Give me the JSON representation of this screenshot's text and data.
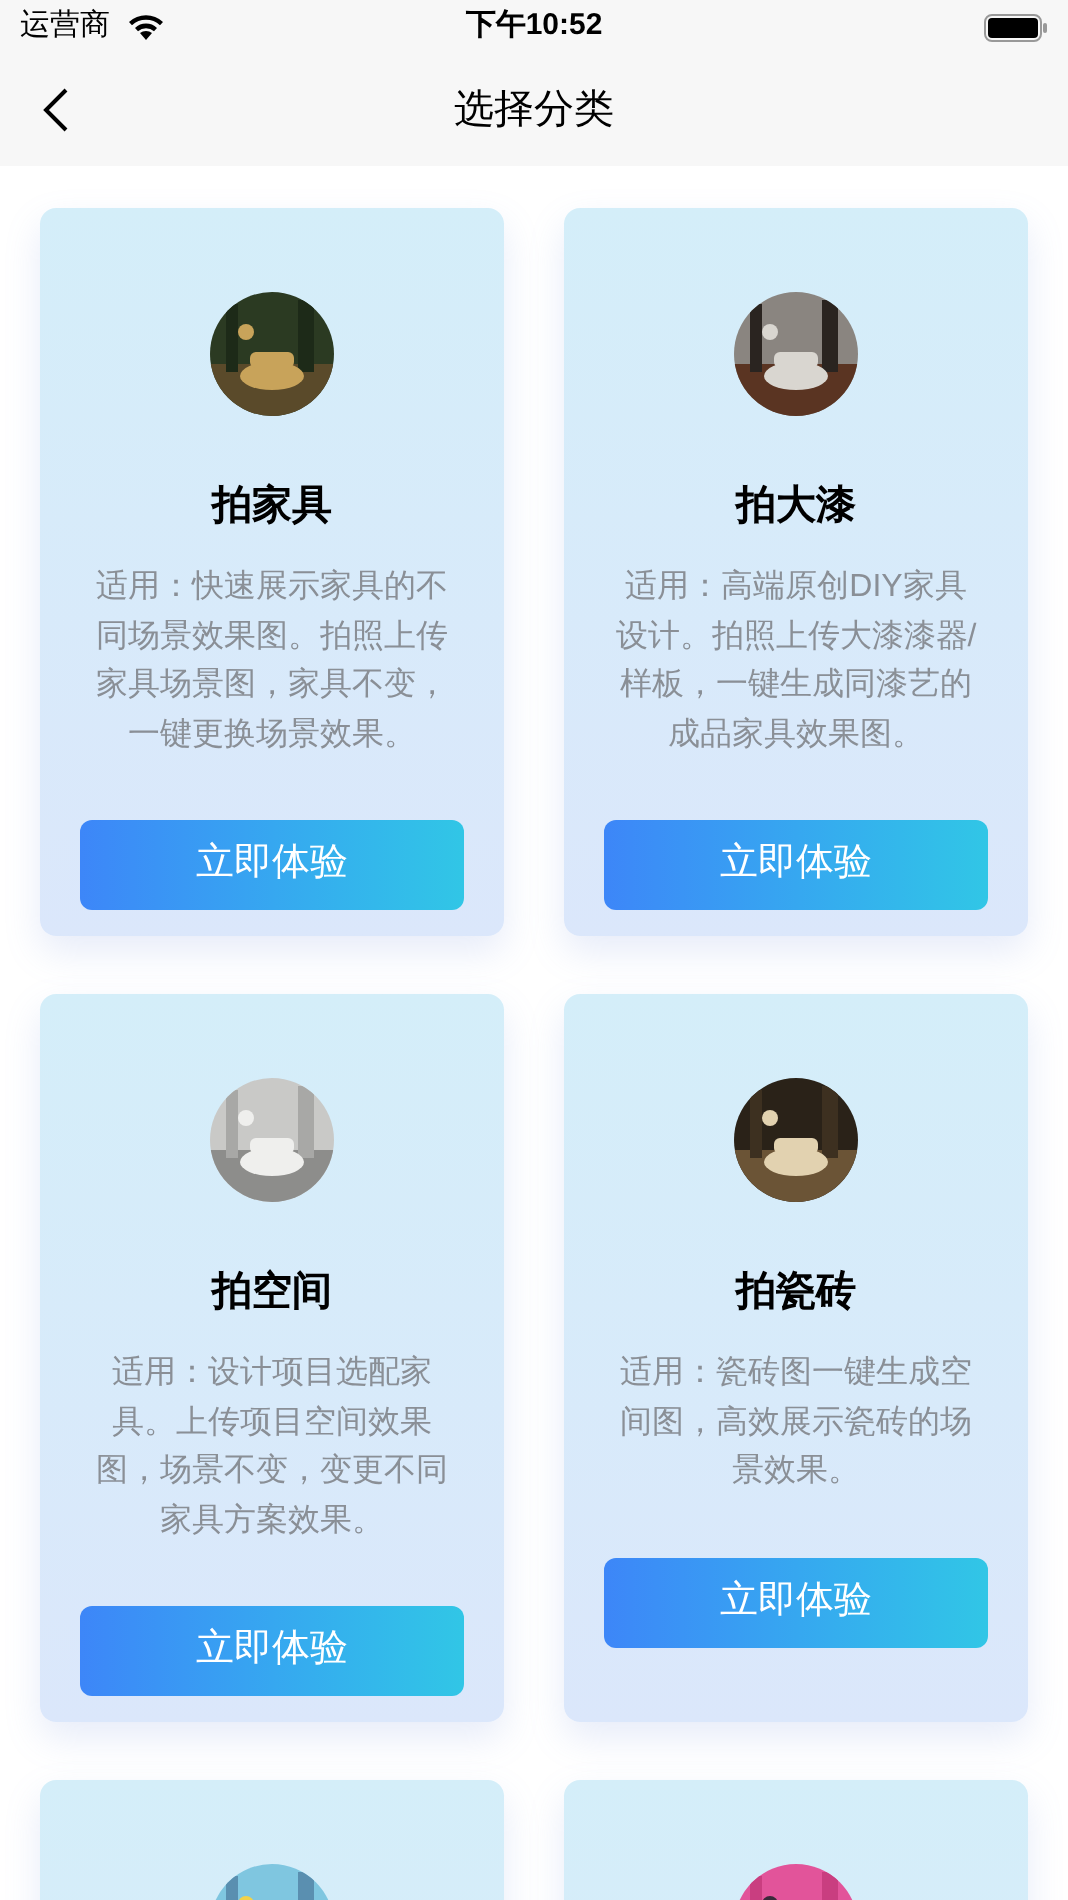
{
  "status_bar": {
    "carrier": "运营商",
    "time": "下午10:52"
  },
  "nav": {
    "title": "选择分类"
  },
  "cards": [
    {
      "title": "拍家具",
      "description": "适用：快速展示家具的不同场景效果图。拍照上传家具场景图，家具不变，一键更换场景效果。",
      "button": "立即体验",
      "picture": {
        "kind": "picture"
      }
    },
    {
      "title": "拍大漆",
      "description": "适用：高端原创DIY家具设计。拍照上传大漆漆器/样板，一键生成同漆艺的成品家具效果图。",
      "button": "立即体验",
      "picture": {
        "kind": "picture"
      }
    },
    {
      "title": "拍空间",
      "description": "适用：设计项目选配家具。上传项目空间效果图，场景不变，变更不同家具方案效果。",
      "button": "立即体验",
      "picture": {
        "kind": "picture"
      }
    },
    {
      "title": "拍瓷砖",
      "description": "适用：瓷砖图一键生成空间图，高效展示瓷砖的场景效果。",
      "button": "立即体验",
      "picture": {
        "kind": "picture"
      }
    },
    {
      "picture": {
        "kind": "picture"
      }
    },
    {
      "picture": {
        "kind": "picture"
      }
    }
  ]
}
